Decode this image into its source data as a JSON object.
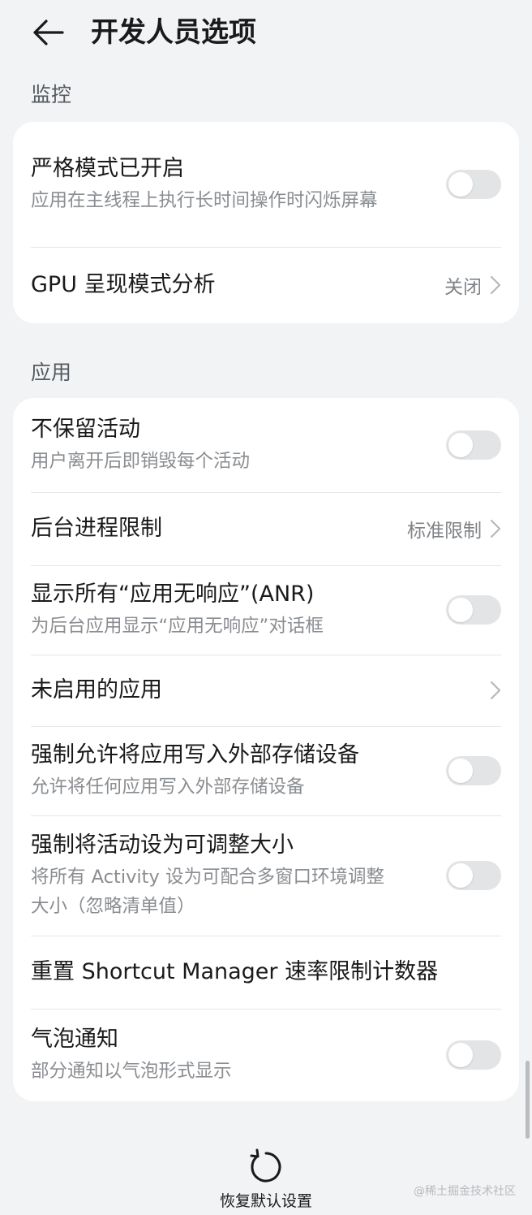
{
  "header": {
    "title": "开发人员选项"
  },
  "sections": {
    "monitoring": {
      "title": "监控",
      "items": [
        {
          "title": "严格模式已开启",
          "subtitle": "应用在主线程上执行长时间操作时闪烁屏幕",
          "toggle_on": false
        },
        {
          "title": "GPU 呈现模式分析",
          "value": "关闭"
        }
      ]
    },
    "apps": {
      "title": "应用",
      "items": [
        {
          "title": "不保留活动",
          "subtitle": "用户离开后即销毁每个活动",
          "toggle_on": false
        },
        {
          "title": "后台进程限制",
          "value": "标准限制"
        },
        {
          "title": "显示所有“应用无响应”(ANR)",
          "subtitle": "为后台应用显示“应用无响应”对话框",
          "toggle_on": false
        },
        {
          "title": "未启用的应用"
        },
        {
          "title": "强制允许将应用写入外部存储设备",
          "subtitle": "允许将任何应用写入外部存储设备",
          "toggle_on": false
        },
        {
          "title": "强制将活动设为可调整大小",
          "subtitle": "将所有 Activity 设为可配合多窗口环境调整大小（忽略清单值）",
          "toggle_on": false
        },
        {
          "title": "重置 Shortcut Manager 速率限制计数器"
        },
        {
          "title": "气泡通知",
          "subtitle": "部分通知以气泡形式显示",
          "toggle_on": false
        }
      ]
    }
  },
  "footer": {
    "reset_label": "恢复默认设置",
    "watermark": "@稀土掘金技术社区"
  },
  "icons": {
    "back": "arrow-left-icon",
    "chevron": "chevron-right-icon",
    "reset": "reset-icon"
  },
  "colors": {
    "background": "#f1f3f5",
    "card": "#ffffff",
    "toggle_off": "#e3e4e6",
    "secondary_text": "#8a8d91"
  }
}
